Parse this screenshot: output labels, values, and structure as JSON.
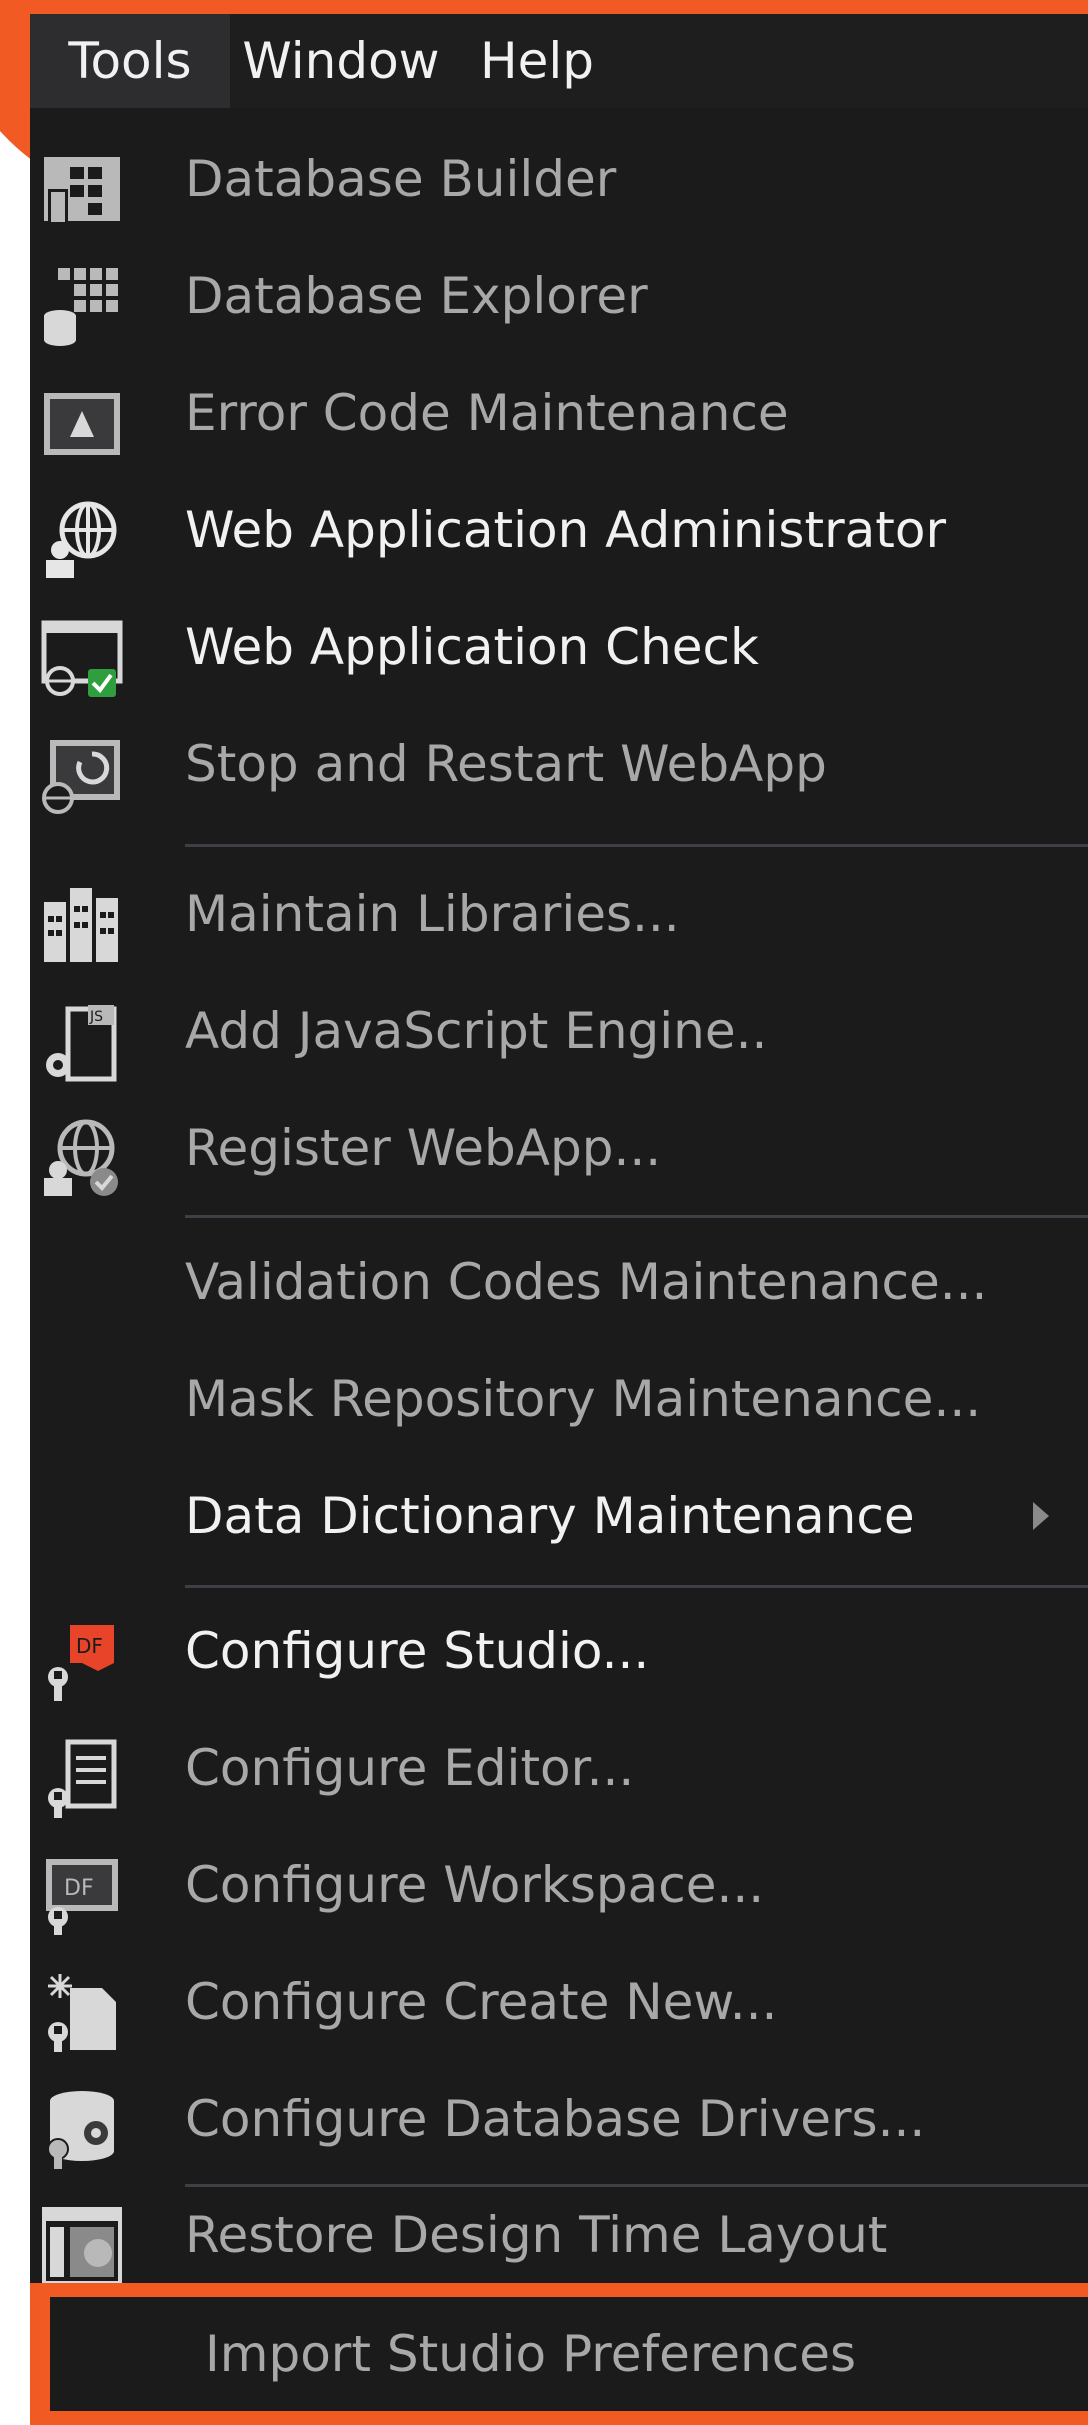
{
  "menubar": {
    "items": [
      {
        "label": "Tools",
        "active": true
      },
      {
        "label": "Window",
        "active": false
      },
      {
        "label": "Help",
        "active": false
      }
    ]
  },
  "menu": {
    "items": [
      {
        "label": "Database Builder",
        "icon": "database-builder-icon",
        "enabled": false
      },
      {
        "label": "Database Explorer",
        "icon": "database-explorer-icon",
        "enabled": false
      },
      {
        "label": "Error Code Maintenance",
        "icon": "error-code-icon",
        "enabled": false
      },
      {
        "label": "Web Application Administrator",
        "icon": "web-app-admin-icon",
        "enabled": true
      },
      {
        "label": "Web Application Check",
        "icon": "web-app-check-icon",
        "enabled": true
      },
      {
        "label": "Stop and Restart WebApp",
        "icon": "restart-webapp-icon",
        "enabled": false
      },
      {
        "label": "Maintain Libraries...",
        "icon": "libraries-icon",
        "enabled": false
      },
      {
        "label": "Add JavaScript Engine..",
        "icon": "javascript-engine-icon",
        "enabled": false
      },
      {
        "label": "Register WebApp...",
        "icon": "register-webapp-icon",
        "enabled": false
      },
      {
        "label": "Validation Codes Maintenance...",
        "icon": "",
        "enabled": false
      },
      {
        "label": "Mask Repository Maintenance...",
        "icon": "",
        "enabled": false
      },
      {
        "label": "Data Dictionary Maintenance",
        "icon": "",
        "enabled": true,
        "submenu": true
      },
      {
        "label": "Configure Studio...",
        "icon": "configure-studio-icon",
        "enabled": true
      },
      {
        "label": "Configure Editor...",
        "icon": "configure-editor-icon",
        "enabled": false
      },
      {
        "label": "Configure Workspace...",
        "icon": "configure-workspace-icon",
        "enabled": false
      },
      {
        "label": "Configure Create New...",
        "icon": "configure-create-new-icon",
        "enabled": false
      },
      {
        "label": "Configure Database Drivers...",
        "icon": "configure-db-drivers-icon",
        "enabled": false
      },
      {
        "label": "Restore Design Time Layout",
        "icon": "restore-layout-icon",
        "enabled": false
      },
      {
        "label": "Import Studio Preferences",
        "icon": "",
        "enabled": false,
        "highlighted": true
      }
    ]
  },
  "colors": {
    "menu_bg": "#1b1b1c",
    "text_enabled": "#f1f1f1",
    "text_disabled": "#a8a8a8",
    "accent": "#f15a22",
    "separator": "#3f3f46",
    "icon_gray": "#b9b9b9",
    "icon_green": "#2e9e3f",
    "icon_red": "#e8442a"
  }
}
